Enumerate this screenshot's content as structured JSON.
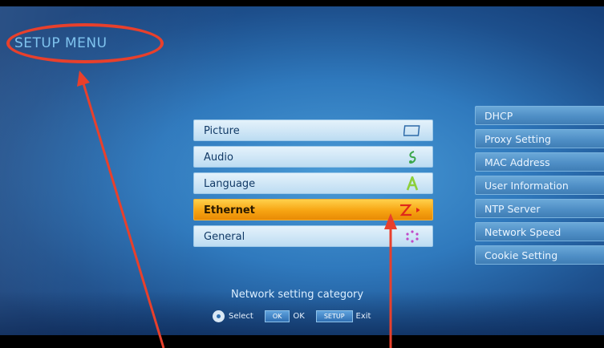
{
  "screen": {
    "title": "SETUP MENU"
  },
  "menu": {
    "items": [
      {
        "label": "Picture",
        "icon": "picture-frame-icon"
      },
      {
        "label": "Audio",
        "icon": "music-note-icon"
      },
      {
        "label": "Language",
        "icon": "letter-a-icon"
      },
      {
        "label": "Ethernet",
        "icon": "ethernet-lightning-icon",
        "selected": true
      },
      {
        "label": "General",
        "icon": "general-dots-icon"
      }
    ]
  },
  "submenu": {
    "items": [
      "DHCP",
      "Proxy Setting",
      "MAC Address",
      "User Information",
      "NTP Server",
      "Network Speed",
      "Cookie Setting"
    ]
  },
  "footer": {
    "category": "Network setting category",
    "select_label": "Select",
    "ok_key": "OK",
    "ok_label": "OK",
    "setup_key": "SETUP",
    "exit_label": "Exit"
  },
  "colors": {
    "background": "#2f79bd",
    "selected": "#f7a412",
    "annotation": "#e8402c"
  }
}
